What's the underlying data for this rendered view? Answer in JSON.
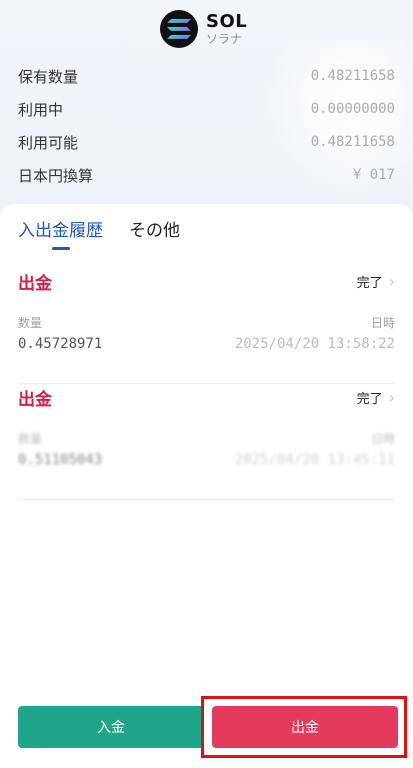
{
  "coin": {
    "symbol": "SOL",
    "name_jp": "ソラナ",
    "logo_icon": "solana-logo-icon"
  },
  "balances": [
    {
      "label": "保有数量",
      "value": "0.48211658"
    },
    {
      "label": "利用中",
      "value": "0.00000000"
    },
    {
      "label": "利用可能",
      "value": "0.48211658"
    },
    {
      "label": "日本円換算",
      "value": "¥ 017"
    }
  ],
  "tabs": [
    {
      "label": "入出金履歴",
      "active": true
    },
    {
      "label": "その他",
      "active": false
    }
  ],
  "history": [
    {
      "type": "出金",
      "status": "完了",
      "amount_label": "数量",
      "date_label": "日時",
      "amount": "0.45728971",
      "date": "2025/04/20 13:58:22"
    },
    {
      "type": "出金",
      "status": "完了",
      "amount_label": "数量",
      "date_label": "日時",
      "amount": "0.51105043",
      "date": "2025/04/20 13:45:11"
    }
  ],
  "buttons": {
    "deposit": "入金",
    "withdraw": "出金"
  },
  "colors": {
    "accent_blue": "#1f56c8",
    "withdraw_red": "#d61d4a",
    "deposit_green": "#1fa58a",
    "withdraw_button": "#e43b5d",
    "highlight_red": "#e01010"
  }
}
